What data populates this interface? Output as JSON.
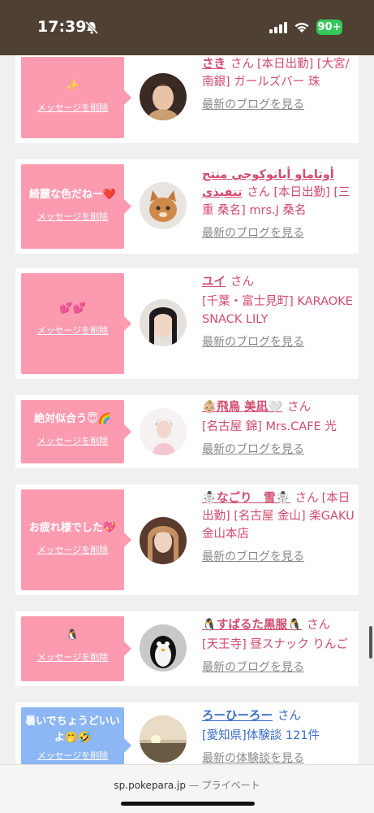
{
  "status_bar": {
    "time": "17:39",
    "battery": "90+"
  },
  "cards": [
    {
      "bubble_text": "✨",
      "delete_label": "メッセージを削除",
      "name": "さき",
      "san": "さん",
      "shop": "[本日出勤] [大宮/南銀] ガールズバー 珠",
      "blog_label": "最新のブログを見る"
    },
    {
      "bubble_text": "綺麗な色だねー❤️",
      "delete_label": "メッセージを削除",
      "name": "أوتاماو أيانوكوجي منتج تنفيذي",
      "san": "さん",
      "shop": "[本日出勤] [三重 桑名] mrs.J 桑名",
      "blog_label": "最新のブログを見る"
    },
    {
      "bubble_text": "💕💕",
      "delete_label": "メッセージを削除",
      "name": "ユイ",
      "san": "さん",
      "shop": "[千葉・富士見町] KARAOKE SNACK LILY",
      "blog_label": "最新のブログを見る"
    },
    {
      "bubble_text": "絶対似合う😇🌈",
      "delete_label": "メッセージを削除",
      "name": "👶🏼飛鳥 美凪🤍",
      "san": "さん",
      "shop": "[名古屋 錦] Mrs.CAFE 光",
      "blog_label": "最新のブログを見る"
    },
    {
      "bubble_text": "お疲れ様でした💖",
      "delete_label": "メッセージを削除",
      "name": "☃️なごり　雪☃️",
      "san": "さん",
      "shop": "[本日出勤] [名古屋 金山] 楽GAKU 金山本店",
      "blog_label": "最新のブログを見る"
    },
    {
      "bubble_text": "🐧",
      "delete_label": "メッセージを削除",
      "name": "🐧すばるた黒服🐧",
      "san": "さん",
      "shop": "[天王寺] 昼スナック りんご",
      "blog_label": "最新のブログを見る"
    },
    {
      "bubble_text": "暑いでちょうどいいよ🤭🤣",
      "delete_label": "メッセージを削除",
      "name": "ろーひーろー",
      "san": "さん",
      "shop": "[愛知県]体験談 121件",
      "blog_label": "最新の体験談を見る"
    }
  ],
  "browser_bar": {
    "url": "sp.pokepara.jp",
    "mode": " — プライベート"
  },
  "colors": {
    "status_bg": "#4e4032",
    "bubble_pink": "#fc9bb0",
    "bubble_blue": "#8cb6f4",
    "name_pink": "#d24b6e",
    "name_blue": "#3a6cc8"
  }
}
